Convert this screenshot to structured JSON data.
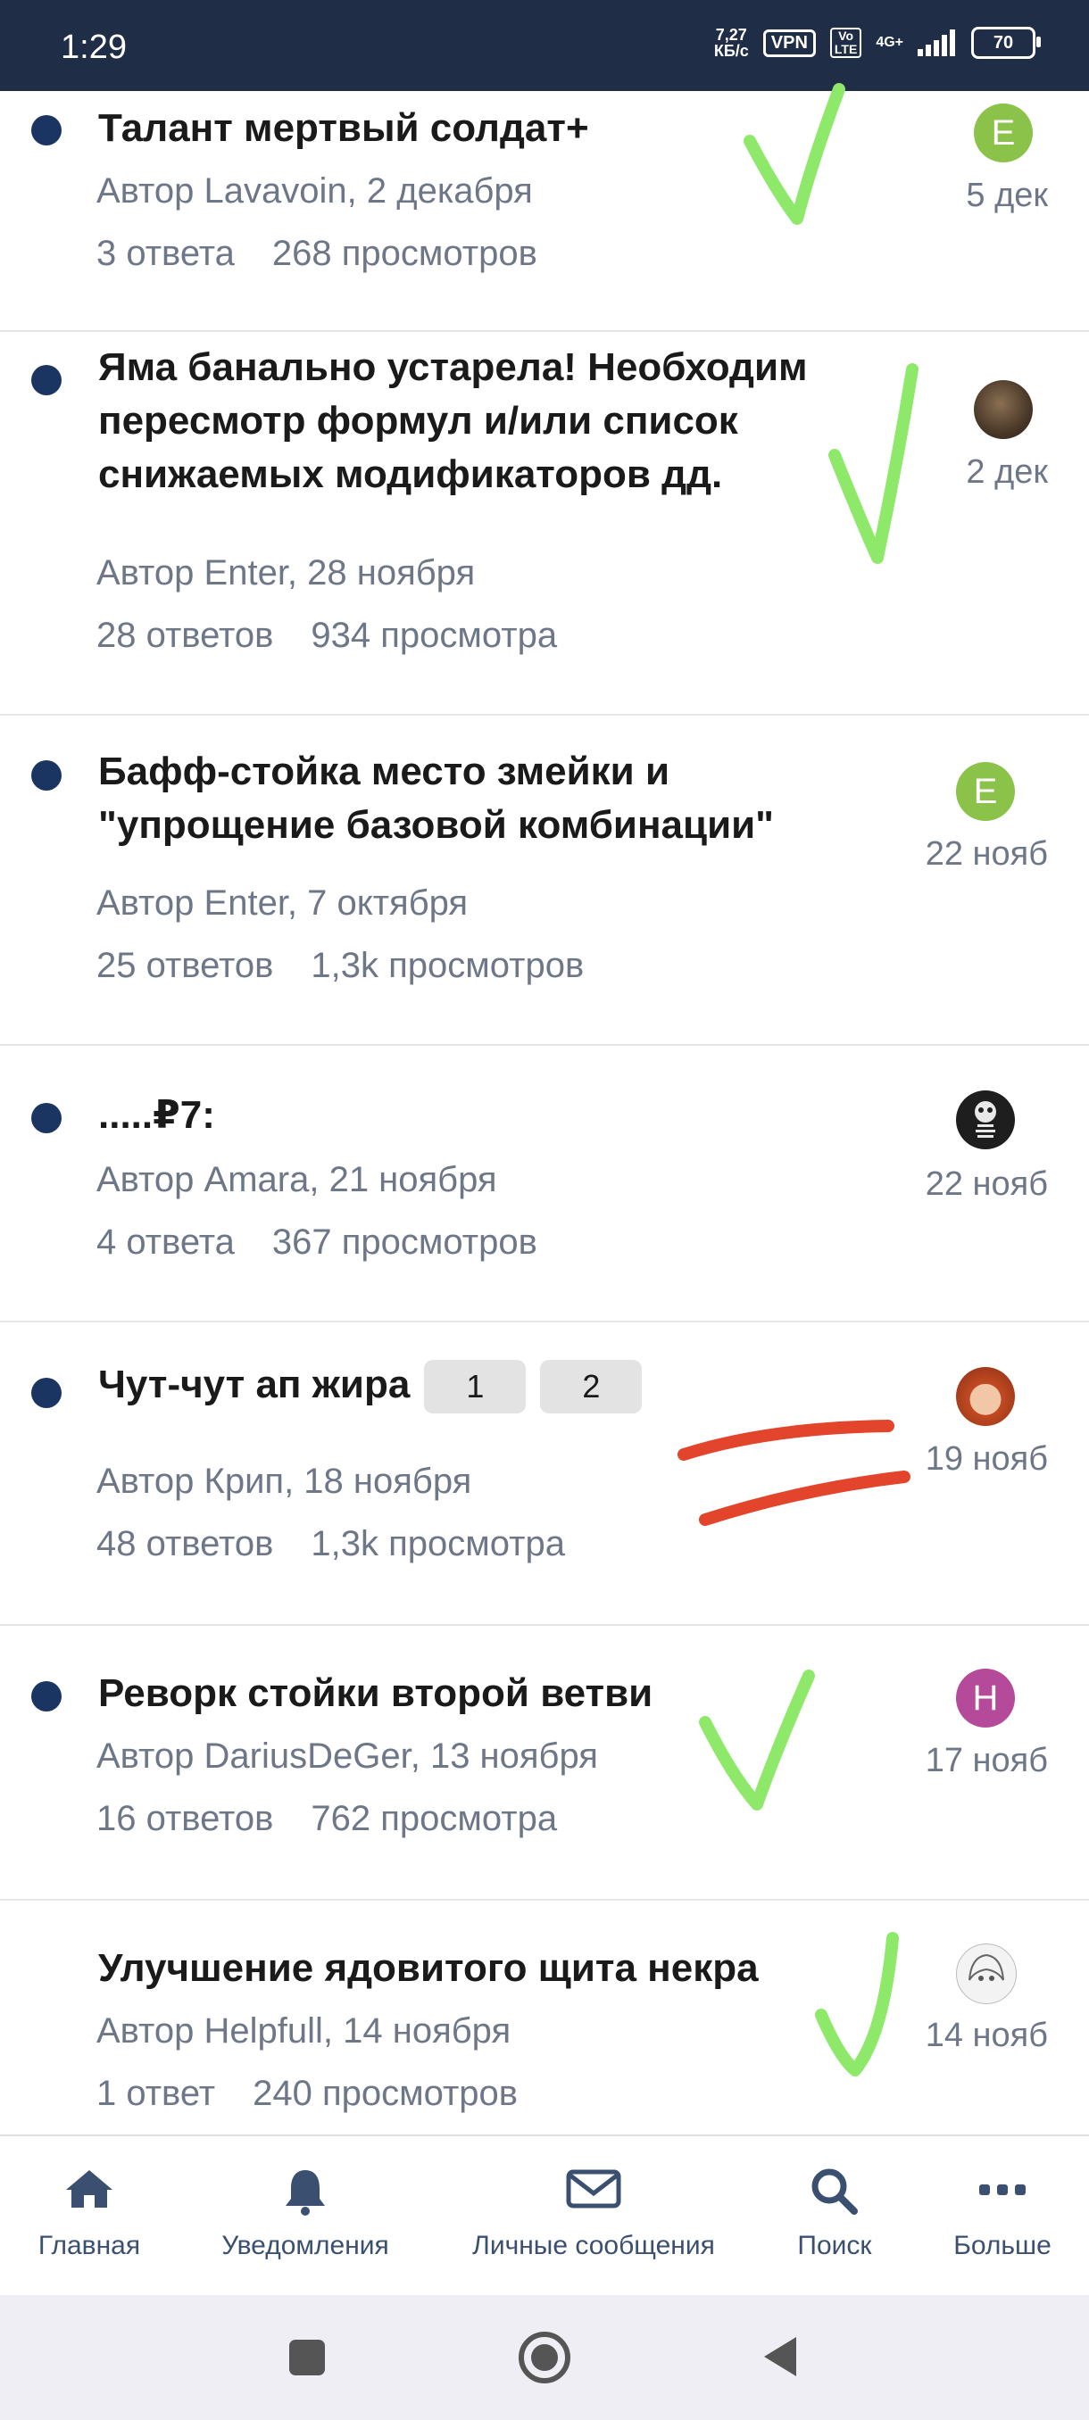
{
  "status_bar": {
    "time": "1:29",
    "speed_value": "7,27",
    "speed_unit": "КБ/с",
    "vpn": "VPN",
    "volte_top": "Vo",
    "volte_bottom": "LTE",
    "network": "4G+",
    "battery": "70"
  },
  "topics": [
    {
      "title": "Талант мертвый солдат+",
      "meta": "Автор Lavavoin, 2 декабря",
      "replies": "3 ответа",
      "views": "268 просмотров",
      "date": "5 дек",
      "avatar": {
        "letter": "E",
        "color": "#8bc34a"
      },
      "unread": true
    },
    {
      "title": "Яма банально устарела! Необходим пересмотр формул и/или список снижаемых модификаторов дд.",
      "meta": "Автор Enter, 28 ноября",
      "replies": "28 ответов",
      "views": "934 просмотра",
      "date": "2 дек",
      "avatar": {
        "letter": "",
        "color": "#5a4636"
      },
      "unread": true
    },
    {
      "title": "Бафф-стойка место змейки и \"упрощение базовой комбинации\"",
      "meta": "Автор Enter, 7 октября",
      "replies": "25 ответов",
      "views": "1,3k просмотров",
      "date": "22 нояб",
      "avatar": {
        "letter": "E",
        "color": "#8bc34a"
      },
      "unread": true
    },
    {
      "title": ".....₽7:",
      "meta": "Автор Amara, 21 ноября",
      "replies": "4 ответа",
      "views": "367 просмотров",
      "date": "22 нояб",
      "avatar": {
        "letter": "",
        "color": "#2a2a2a"
      },
      "unread": true
    },
    {
      "title": "Чут-чут ап жира",
      "pages": [
        "1",
        "2"
      ],
      "meta": "Автор Крип, 18 ноября",
      "replies": "48 ответов",
      "views": "1,3k просмотра",
      "date": "19 нояб",
      "avatar": {
        "letter": "",
        "color": "#c0502a"
      },
      "unread": true
    },
    {
      "title": "Реворк стойки второй ветви",
      "meta": "Автор DariusDeGer, 13 ноября",
      "replies": "16 ответов",
      "views": "762 просмотра",
      "date": "17 нояб",
      "avatar": {
        "letter": "H",
        "color": "#b5499a"
      },
      "unread": true
    },
    {
      "title": "Улучшение ядовитого щита некра",
      "meta": "Автор Helpfull, 14 ноября",
      "replies": "1 ответ",
      "views": "240 просмотров",
      "date": "14 нояб",
      "avatar": {
        "letter": "",
        "color": "#e8e8e8"
      },
      "unread": false
    }
  ],
  "bottom_nav": [
    {
      "label": "Главная",
      "icon": "home-icon"
    },
    {
      "label": "Уведомления",
      "icon": "bell-icon"
    },
    {
      "label": "Личные сообщения",
      "icon": "envelope-icon"
    },
    {
      "label": "Поиск",
      "icon": "search-icon"
    },
    {
      "label": "Больше",
      "icon": "more-dots-icon"
    }
  ],
  "colors": {
    "status_bar_bg": "#1f2d47",
    "unread_dot": "#1b3562",
    "muted_text": "#6e7787",
    "annotation_check": "#8ee86a",
    "annotation_strike": "#e2452b",
    "nav_icon": "#3b5070"
  }
}
